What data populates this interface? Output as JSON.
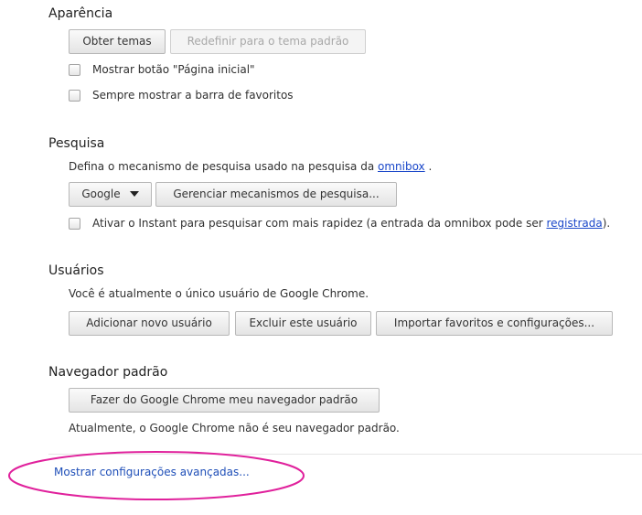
{
  "appearance": {
    "title": "Aparência",
    "get_themes": "Obter temas",
    "reset_theme": "Redefinir para o tema padrão",
    "show_home": "Mostrar botão \"Página inicial\"",
    "show_bookmarks": "Sempre mostrar a barra de favoritos"
  },
  "search": {
    "title": "Pesquisa",
    "desc_prefix": "Defina o mecanismo de pesquisa usado na pesquisa da ",
    "desc_link": "omnibox",
    "desc_suffix": " .",
    "engine": "Google",
    "manage": "Gerenciar mecanismos de pesquisa...",
    "instant_prefix": "Ativar o Instant para pesquisar com mais rapidez (a entrada da omnibox pode ser ",
    "instant_link": "registrada",
    "instant_suffix": ")."
  },
  "users": {
    "title": "Usuários",
    "desc": "Você é atualmente o único usuário de Google Chrome.",
    "add": "Adicionar novo usuário",
    "delete": "Excluir este usuário",
    "import": "Importar favoritos e configurações..."
  },
  "default_browser": {
    "title": "Navegador padrão",
    "make_default": "Fazer do Google Chrome meu navegador padrão",
    "status": "Atualmente, o Google Chrome não é seu navegador padrão."
  },
  "advanced_link": "Mostrar configurações avançadas...",
  "colors": {
    "highlight_ellipse": "#e0219c",
    "link": "#1a47c9"
  }
}
